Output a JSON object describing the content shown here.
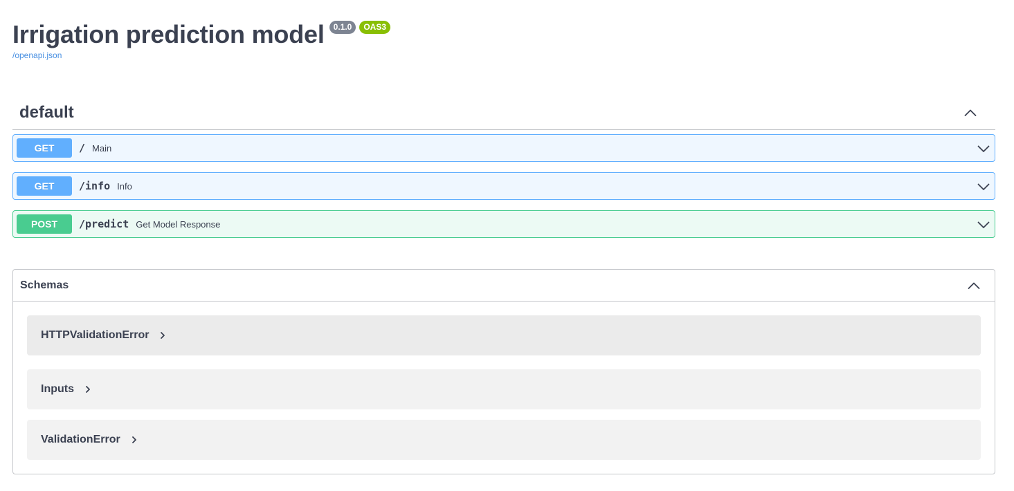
{
  "info": {
    "title": "Irrigation prediction model",
    "version": "0.1.0",
    "oas": "OAS3",
    "spec_link": "/openapi.json"
  },
  "tag": {
    "name": "default",
    "expanded": true
  },
  "operations": [
    {
      "method": "GET",
      "path": "/",
      "summary": "Main"
    },
    {
      "method": "GET",
      "path": "/info",
      "summary": "Info"
    },
    {
      "method": "POST",
      "path": "/predict",
      "summary": "Get Model Response"
    }
  ],
  "schemas": {
    "title": "Schemas",
    "items": [
      "HTTPValidationError",
      "Inputs",
      "ValidationError"
    ]
  },
  "icons": {
    "collapse": "chevron-up-icon",
    "expand": "chevron-down-icon",
    "model_expand": "chevron-right-icon"
  },
  "colors": {
    "get": "#61affe",
    "post": "#49cc90",
    "version_badge": "#7d8492",
    "oas_badge": "#89bf04",
    "link": "#4990e2",
    "text": "#3b4151"
  }
}
